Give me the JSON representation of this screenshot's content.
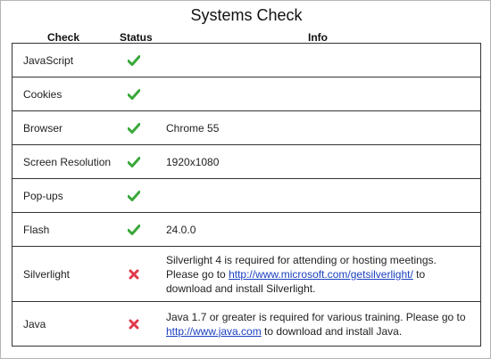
{
  "page": {
    "title": "Systems Check"
  },
  "headers": {
    "check": "Check",
    "status": "Status",
    "info": "Info"
  },
  "colors": {
    "ok": "#3aa83a",
    "fail": "#e0394b",
    "link": "#1a3fbf"
  },
  "rows": [
    {
      "check": "JavaScript",
      "status": "ok",
      "status_icon": "check-icon",
      "info": ""
    },
    {
      "check": "Cookies",
      "status": "ok",
      "status_icon": "check-icon",
      "info": ""
    },
    {
      "check": "Browser",
      "status": "ok",
      "status_icon": "check-icon",
      "info": "Chrome 55"
    },
    {
      "check": "Screen Resolution",
      "status": "ok",
      "status_icon": "check-icon",
      "info": "1920x1080"
    },
    {
      "check": "Pop-ups",
      "status": "ok",
      "status_icon": "check-icon",
      "info": ""
    },
    {
      "check": "Flash",
      "status": "ok",
      "status_icon": "check-icon",
      "info": "24.0.0"
    },
    {
      "check": "Silverlight",
      "status": "fail",
      "status_icon": "x-icon",
      "info_before": "Silverlight 4 is required for attending or hosting meetings. Please go to ",
      "info_link": "http://www.microsoft.com/getsilverlight/",
      "info_after": " to download and install Silverlight."
    },
    {
      "check": "Java",
      "status": "fail",
      "status_icon": "x-icon",
      "info_before": "Java 1.7 or greater is required for various training. Please go to ",
      "info_link": "http://www.java.com",
      "info_after": " to download and install Java."
    }
  ]
}
